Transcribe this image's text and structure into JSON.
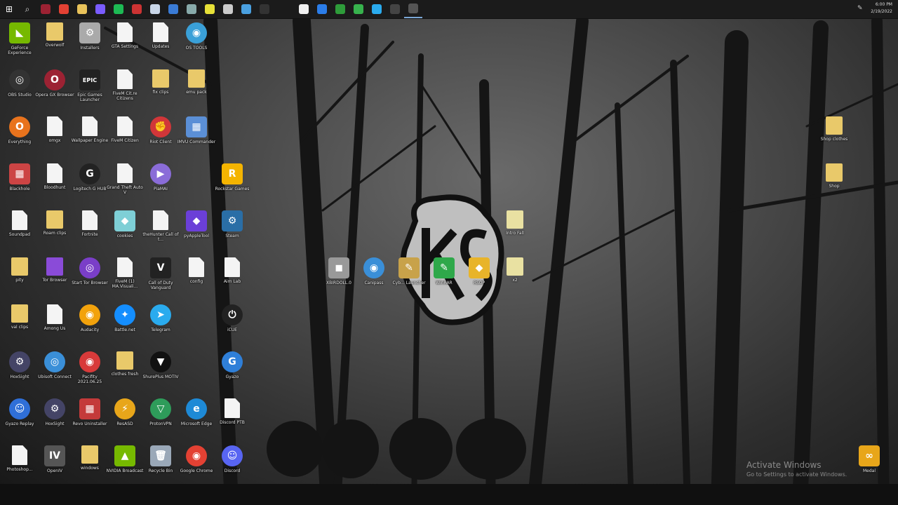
{
  "taskbar": {
    "apps": [
      {
        "icon": "windows-start-icon",
        "color": "#ffffff"
      },
      {
        "icon": "search-icon",
        "color": "#dddddd"
      },
      {
        "icon": "app-red-icon",
        "color": "#9c2233"
      },
      {
        "icon": "chrome-icon",
        "color": "#e34133"
      },
      {
        "icon": "file-explorer-icon",
        "color": "#e8c25a"
      },
      {
        "icon": "app-purple-icon",
        "color": "#7a5cff"
      },
      {
        "icon": "spotify-icon",
        "color": "#1db954"
      },
      {
        "icon": "app-tile-icon",
        "color": "#cc3333"
      },
      {
        "icon": "steam-icon",
        "color": "#c9d6e8"
      },
      {
        "icon": "app-blue-icon",
        "color": "#3a7bd5"
      },
      {
        "icon": "app-gray-icon",
        "color": "#8aa"
      },
      {
        "icon": "app-yellow-icon",
        "color": "#e7e138"
      },
      {
        "icon": "app-circle-icon",
        "color": "#cccccc"
      },
      {
        "icon": "app-check-icon",
        "color": "#4aa0e0"
      },
      {
        "icon": "app-shield-icon",
        "color": "#333333"
      },
      {
        "icon": "document-icon",
        "color": "#f0f0f0"
      },
      {
        "icon": "app-triangle-icon",
        "color": "#2b7de9"
      },
      {
        "icon": "app-green-square-icon",
        "color": "#2e9c3a"
      },
      {
        "icon": "app-green-round-icon",
        "color": "#37b24d"
      },
      {
        "icon": "telegram-icon",
        "color": "#2aabee"
      },
      {
        "icon": "app-dark-round-icon",
        "color": "#444444"
      },
      {
        "icon": "app-active-icon",
        "color": "#555555"
      }
    ],
    "time": "6:00 PM",
    "date": "2/19/2022"
  },
  "icons": [
    {
      "label": "GeForce Experience",
      "color": "#76b900",
      "type": "tile",
      "glyph": "◣"
    },
    {
      "label": "Overwolf",
      "color": "#e9c96a",
      "type": "folder",
      "glyph": ""
    },
    {
      "label": "Installers",
      "color": "#aaaaaa",
      "type": "tile",
      "glyph": "⚙"
    },
    {
      "label": "GTA Settings",
      "color": "",
      "type": "file",
      "glyph": ""
    },
    {
      "label": "Updates",
      "color": "",
      "type": "file",
      "glyph": ""
    },
    {
      "label": "OS TOOLS",
      "color": "#3aa0d8",
      "type": "round",
      "glyph": "◉"
    },
    {
      "label": "OBS Studio",
      "color": "#333333",
      "type": "round",
      "glyph": "◎"
    },
    {
      "label": "Opera GX Browser",
      "color": "#9c2233",
      "type": "round",
      "glyph": "O"
    },
    {
      "label": "Epic Games Launcher",
      "color": "#222222",
      "type": "tile",
      "glyph": "EPIC"
    },
    {
      "label": "FiveM Cit.re Citizens",
      "color": "",
      "type": "file",
      "glyph": ""
    },
    {
      "label": "fix clips",
      "color": "#e9c96a",
      "type": "folder",
      "glyph": ""
    },
    {
      "label": "emu pack",
      "color": "#e9c96a",
      "type": "folder",
      "glyph": ""
    },
    {
      "label": "Everything",
      "color": "#e8731d",
      "type": "round",
      "glyph": "O"
    },
    {
      "label": "omgx",
      "color": "",
      "type": "file",
      "glyph": ""
    },
    {
      "label": "Wallpaper Engine",
      "color": "",
      "type": "file",
      "glyph": ""
    },
    {
      "label": "FiveM Citizen",
      "color": "",
      "type": "file",
      "glyph": ""
    },
    {
      "label": "Riot Client",
      "color": "#d13639",
      "type": "round",
      "glyph": "✊"
    },
    {
      "label": "IMVU Commander",
      "color": "#5b8fd6",
      "type": "tile",
      "glyph": "▦"
    },
    {
      "label": "Blackhole",
      "color": "#cc4444",
      "type": "tile",
      "glyph": "▦"
    },
    {
      "label": "Bloodhunt",
      "color": "",
      "type": "file",
      "glyph": ""
    },
    {
      "label": "Logitech G HUB",
      "color": "#222222",
      "type": "round",
      "glyph": "G"
    },
    {
      "label": "Grand Theft Auto V",
      "color": "",
      "type": "file",
      "glyph": ""
    },
    {
      "label": "PiaMAI",
      "color": "#8a6cd8",
      "type": "round",
      "glyph": "▶"
    },
    {
      "label": "Rockstar Games",
      "color": "#f4b400",
      "type": "tile",
      "glyph": "R"
    },
    {
      "label": "Soundpad",
      "color": "",
      "type": "file",
      "glyph": ""
    },
    {
      "label": "Roam clips",
      "color": "#e9c96a",
      "type": "folder",
      "glyph": ""
    },
    {
      "label": "Fortnite",
      "color": "",
      "type": "file",
      "glyph": ""
    },
    {
      "label": "cookies",
      "color": "#7ecfd6",
      "type": "tile",
      "glyph": "◆"
    },
    {
      "label": "theHunter Call of t...",
      "color": "",
      "type": "file",
      "glyph": ""
    },
    {
      "label": "pyAppleTool",
      "color": "#6b3fd8",
      "type": "tile",
      "glyph": "◆"
    },
    {
      "label": "Steam",
      "color": "#2a6ea6",
      "type": "tile",
      "glyph": "⚙"
    },
    {
      "label": "pity",
      "color": "#e9c96a",
      "type": "folder",
      "glyph": ""
    },
    {
      "label": "Tor Browser",
      "color": "#8a4bd8",
      "type": "folder",
      "glyph": ""
    },
    {
      "label": "Start Tor Browser",
      "color": "#7a3ec8",
      "type": "round",
      "glyph": "◎"
    },
    {
      "label": "FiveM (1) MA.Visuali...",
      "color": "",
      "type": "file",
      "glyph": ""
    },
    {
      "label": "Call of Duty Vanguard",
      "color": "#222222",
      "type": "tile",
      "glyph": "V"
    },
    {
      "label": "config",
      "color": "",
      "type": "file",
      "glyph": ""
    },
    {
      "label": "Aim Lab",
      "color": "",
      "type": "file",
      "glyph": ""
    },
    {
      "label": "val clips",
      "color": "#e9c96a",
      "type": "folder",
      "glyph": ""
    },
    {
      "label": "Among Us",
      "color": "",
      "type": "file",
      "glyph": ""
    },
    {
      "label": "Audacity",
      "color": "#f2a20c",
      "type": "round",
      "glyph": "◉"
    },
    {
      "label": "Battle.net",
      "color": "#148eff",
      "type": "round",
      "glyph": "✦"
    },
    {
      "label": "Telegram",
      "color": "#2aabee",
      "type": "round",
      "glyph": "➤"
    },
    {
      "label": "iCUE",
      "color": "#222222",
      "type": "round",
      "glyph": "⏻"
    },
    {
      "label": "HoxSight",
      "color": "#444466",
      "type": "round",
      "glyph": "⚙"
    },
    {
      "label": "Ubisoft Connect",
      "color": "#3a8fd8",
      "type": "round",
      "glyph": "◎"
    },
    {
      "label": "Pacifity 2021.06.25",
      "color": "#d83a3a",
      "type": "round",
      "glyph": "◉"
    },
    {
      "label": "clothes fresh",
      "color": "#e9c96a",
      "type": "folder",
      "glyph": ""
    },
    {
      "label": "ShurePlus MOTIV",
      "color": "#111111",
      "type": "round",
      "glyph": "▼"
    },
    {
      "label": "Gyazo",
      "color": "#2f7fd8",
      "type": "round",
      "glyph": "G"
    },
    {
      "label": "Gyazo Replay",
      "color": "#2f6fd8",
      "type": "round",
      "glyph": "☺"
    },
    {
      "label": "HoxSight",
      "color": "#444466",
      "type": "round",
      "glyph": "⚙"
    },
    {
      "label": "Revo Uninstaller",
      "color": "#c43a3a",
      "type": "tile",
      "glyph": "▦"
    },
    {
      "label": "ResASD",
      "color": "#e8a61a",
      "type": "round",
      "glyph": "⚡"
    },
    {
      "label": "ProtonVPN",
      "color": "#2e9c5a",
      "type": "round",
      "glyph": "▽"
    },
    {
      "label": "Microsoft Edge",
      "color": "#1e8ad6",
      "type": "round",
      "glyph": "e"
    },
    {
      "label": "Discord PTB",
      "color": "",
      "type": "file",
      "glyph": ""
    },
    {
      "label": "Photoshop...",
      "color": "",
      "type": "file",
      "glyph": ""
    },
    {
      "label": "OpenIV",
      "color": "#555555",
      "type": "tile",
      "glyph": "IV"
    },
    {
      "label": "windows",
      "color": "#e9c96a",
      "type": "folder",
      "glyph": ""
    },
    {
      "label": "NVIDIA Broadcast",
      "color": "#76b900",
      "type": "tile",
      "glyph": "▲"
    },
    {
      "label": "Recycle Bin",
      "color": "#9aa8b8",
      "type": "tile",
      "glyph": "🗑"
    },
    {
      "label": "Google Chrome",
      "color": "#e34133",
      "type": "round",
      "glyph": "◉"
    },
    {
      "label": "Discord",
      "color": "#5865f2",
      "type": "round",
      "glyph": "☺"
    },
    {
      "label": "XBIRDOLL.0",
      "color": "#999999",
      "type": "tile",
      "glyph": "◼"
    },
    {
      "label": "Canipass",
      "color": "#3a8fd8",
      "type": "round",
      "glyph": "◉"
    },
    {
      "label": "Cyb... Launcher",
      "color": "#c8a24a",
      "type": "tile",
      "glyph": "✎"
    },
    {
      "label": "WinRAR",
      "color": "#2ea84a",
      "type": "tile",
      "glyph": "✎"
    },
    {
      "label": "RSOP",
      "color": "#e8b42a",
      "type": "tile",
      "glyph": "◆"
    },
    {
      "label": "Intro Fall",
      "color": "#e9e1a2",
      "type": "folder",
      "glyph": ""
    },
    {
      "label": "x2",
      "color": "#e9e1a2",
      "type": "folder",
      "glyph": ""
    },
    {
      "label": "Shop clothes",
      "color": "#e9c96a",
      "type": "folder",
      "glyph": ""
    },
    {
      "label": "Shop",
      "color": "#e9c96a",
      "type": "folder",
      "glyph": ""
    },
    {
      "label": "Medal",
      "color": "#e8a61a",
      "type": "tile",
      "glyph": "∞"
    }
  ],
  "watermark": {
    "title": "Activate Windows",
    "subtitle": "Go to Settings to activate Windows."
  }
}
